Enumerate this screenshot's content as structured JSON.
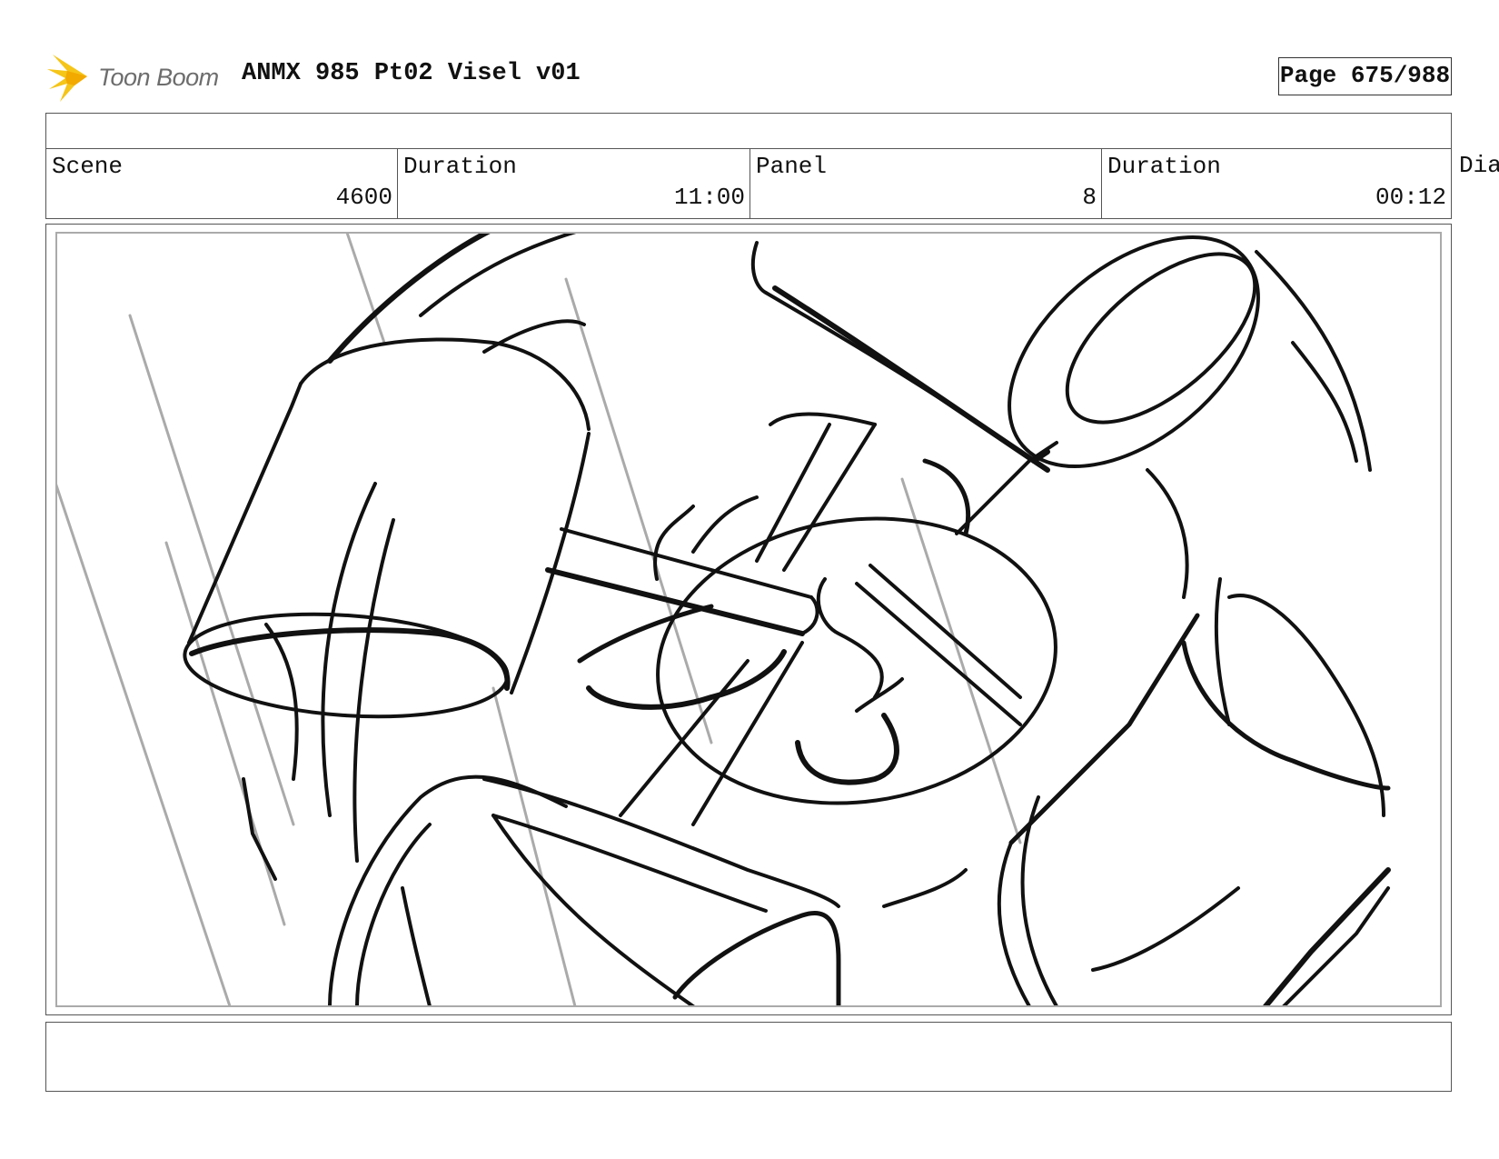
{
  "header": {
    "logo_text": "Toon Boom",
    "logo_color": "#f5c518",
    "title": "ANMX 985 Pt02 Visel v01",
    "page_label": "Page 675/988"
  },
  "info": {
    "scene_label": "Scene",
    "scene_value": "4600",
    "scene_duration_label": "Duration",
    "scene_duration_value": "11:00",
    "panel_label": "Panel",
    "panel_value": "8",
    "panel_duration_label": "Duration",
    "panel_duration_value": "00:12",
    "dialog_label": "Dia"
  },
  "panel": {
    "image": "storyboard-sketch-mallet-swing"
  }
}
